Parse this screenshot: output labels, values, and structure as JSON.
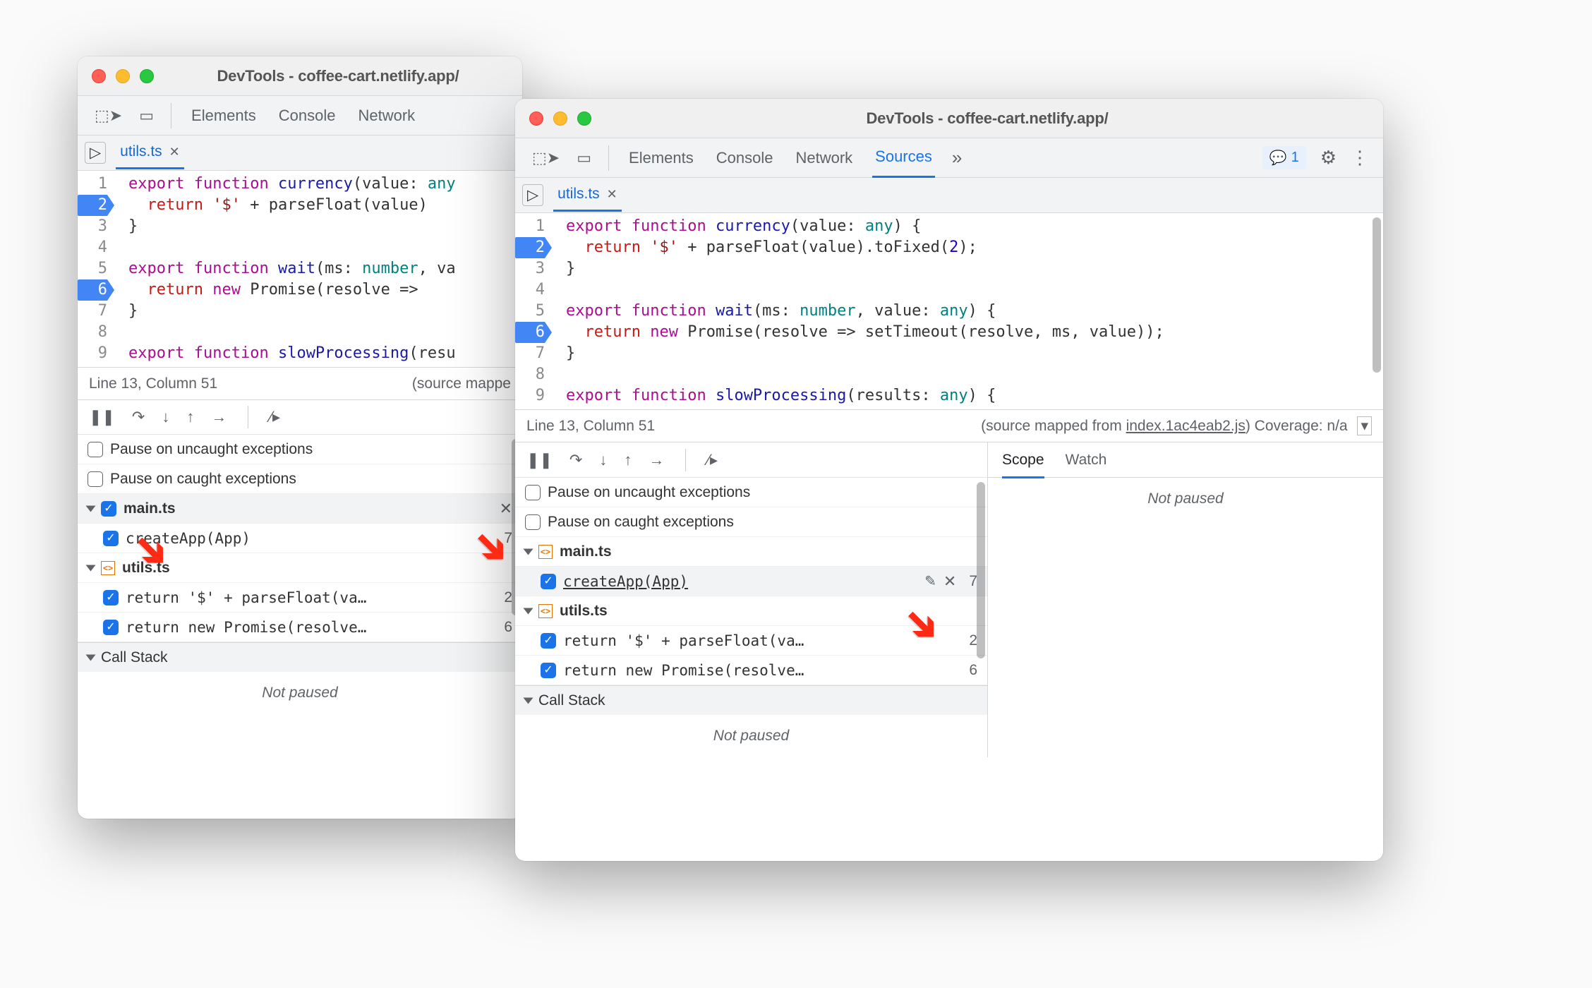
{
  "windows": {
    "left": {
      "title": "DevTools - coffee-cart.netlify.app/",
      "tabs": [
        "Elements",
        "Console",
        "Network"
      ],
      "file_tab": "utils.ts",
      "code_lines": [
        {
          "n": 1,
          "bp": false,
          "html": "<span class='kw2'>export</span> <span class='kw2'>function</span> <span class='fn'>currency</span>(value: <span class='ty'>any</span>"
        },
        {
          "n": 2,
          "bp": true,
          "html": "  <span class='kw'>return</span> <span class='str'>'$'</span> + parseFloat(value)"
        },
        {
          "n": 3,
          "bp": false,
          "html": "}"
        },
        {
          "n": 4,
          "bp": false,
          "html": ""
        },
        {
          "n": 5,
          "bp": false,
          "html": "<span class='kw2'>export</span> <span class='kw2'>function</span> <span class='fn'>wait</span>(ms: <span class='ty'>number</span>, va"
        },
        {
          "n": 6,
          "bp": true,
          "html": "  <span class='kw'>return</span> <span class='kw2'>new</span> Promise(resolve =&gt; "
        },
        {
          "n": 7,
          "bp": false,
          "html": "}"
        },
        {
          "n": 8,
          "bp": false,
          "html": ""
        },
        {
          "n": 9,
          "bp": false,
          "html": "<span class='kw2'>export</span> <span class='kw2'>function</span> <span class='fn'>slowProcessing</span>(resu"
        }
      ],
      "status_left": "Line 13, Column 51",
      "status_right": "(source mappe",
      "pause_uncaught": "Pause on uncaught exceptions",
      "pause_caught": "Pause on caught exceptions",
      "bp_groups": [
        {
          "file": "main.ts",
          "checked": true,
          "show_x": true,
          "items": [
            {
              "label": "createApp(App)",
              "line": 7,
              "checked": true
            }
          ]
        },
        {
          "file": "utils.ts",
          "checked": null,
          "items": [
            {
              "label": "return '$' + parseFloat(va…",
              "line": 2,
              "checked": true
            },
            {
              "label": "return new Promise(resolve…",
              "line": 6,
              "checked": true
            }
          ]
        }
      ],
      "callstack": "Call Stack",
      "not_paused": "Not paused"
    },
    "right": {
      "title": "DevTools - coffee-cart.netlify.app/",
      "tabs": [
        "Elements",
        "Console",
        "Network",
        "Sources"
      ],
      "active_tab": "Sources",
      "issues_count": 1,
      "file_tab": "utils.ts",
      "code_lines": [
        {
          "n": 1,
          "bp": false,
          "html": "<span class='kw2'>export</span> <span class='kw2'>function</span> <span class='fn'>currency</span>(value: <span class='ty'>any</span>) {"
        },
        {
          "n": 2,
          "bp": true,
          "html": "  <span class='kw'>return</span> <span class='str'>'$'</span> + parseFloat(value).toFixed(<span class='num'>2</span>);"
        },
        {
          "n": 3,
          "bp": false,
          "html": "}"
        },
        {
          "n": 4,
          "bp": false,
          "html": ""
        },
        {
          "n": 5,
          "bp": false,
          "html": "<span class='kw2'>export</span> <span class='kw2'>function</span> <span class='fn'>wait</span>(ms: <span class='ty'>number</span>, value: <span class='ty'>any</span>) {"
        },
        {
          "n": 6,
          "bp": true,
          "html": "  <span class='kw'>return</span> <span class='kw2'>new</span> Promise(resolve =&gt; setTimeout(resolve, ms, value));"
        },
        {
          "n": 7,
          "bp": false,
          "html": "}"
        },
        {
          "n": 8,
          "bp": false,
          "html": ""
        },
        {
          "n": 9,
          "bp": false,
          "html": "<span class='kw2'>export</span> <span class='kw2'>function</span> <span class='fn'>slowProcessing</span>(results: <span class='ty'>any</span>) {"
        }
      ],
      "status_left": "Line 13, Column 51",
      "status_right_prefix": "(source mapped from ",
      "status_right_link": "index.1ac4eab2.js",
      "status_right_suffix": ") Coverage: n/a",
      "pause_uncaught": "Pause on uncaught exceptions",
      "pause_caught": "Pause on caught exceptions",
      "bp_groups": [
        {
          "file": "main.ts",
          "checked": null,
          "items": [
            {
              "label": "createApp(App)",
              "line": 7,
              "checked": true,
              "underlined": true,
              "show_edit": true
            }
          ]
        },
        {
          "file": "utils.ts",
          "checked": null,
          "items": [
            {
              "label": "return '$' + parseFloat(va…",
              "line": 2,
              "checked": true
            },
            {
              "label": "return new Promise(resolve…",
              "line": 6,
              "checked": true
            }
          ]
        }
      ],
      "callstack": "Call Stack",
      "not_paused": "Not paused",
      "scope_tabs": [
        "Scope",
        "Watch"
      ],
      "scope_not_paused": "Not paused"
    }
  }
}
